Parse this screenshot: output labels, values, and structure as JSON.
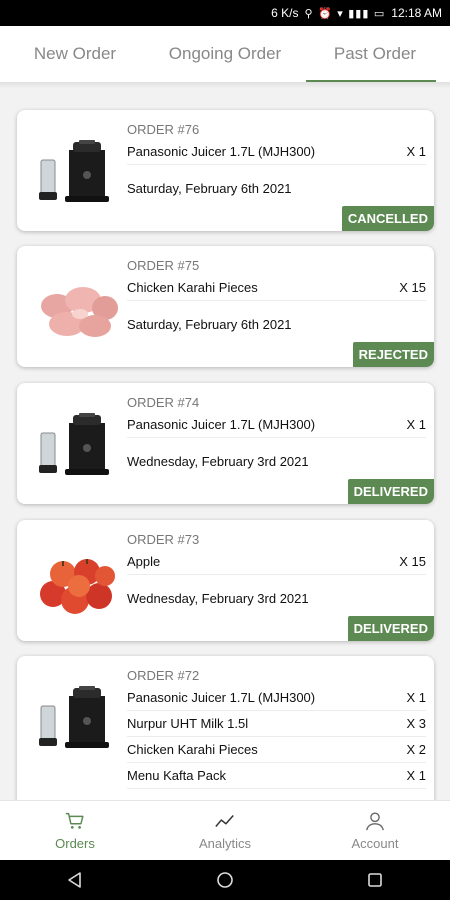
{
  "status_bar": {
    "speed": "6 K/s",
    "icons": "⚲ ⏰ ▾ ▮▮▮ ▭",
    "time": "12:18 AM"
  },
  "tabs": [
    {
      "label": "New Order",
      "active": false
    },
    {
      "label": "Ongoing Order",
      "active": false
    },
    {
      "label": "Past Order",
      "active": true
    }
  ],
  "orders": [
    {
      "number": "ORDER #76",
      "thumbnail": "juicer",
      "items": [
        {
          "name": "Panasonic Juicer 1.7L (MJH300)",
          "qty": "X 1"
        }
      ],
      "date": "Saturday, February 6th 2021",
      "status": "CANCELLED"
    },
    {
      "number": "ORDER #75",
      "thumbnail": "chicken-pieces",
      "items": [
        {
          "name": "Chicken Karahi Pieces",
          "qty": "X 15"
        }
      ],
      "date": "Saturday, February 6th 2021",
      "status": "REJECTED"
    },
    {
      "number": "ORDER #74",
      "thumbnail": "juicer",
      "items": [
        {
          "name": "Panasonic Juicer 1.7L (MJH300)",
          "qty": "X 1"
        }
      ],
      "date": "Wednesday, February 3rd 2021",
      "status": "DELIVERED"
    },
    {
      "number": "ORDER #73",
      "thumbnail": "apples",
      "items": [
        {
          "name": "Apple",
          "qty": "X 15"
        }
      ],
      "date": "Wednesday, February 3rd 2021",
      "status": "DELIVERED"
    },
    {
      "number": "ORDER #72",
      "thumbnail": "juicer",
      "items": [
        {
          "name": "Panasonic Juicer 1.7L (MJH300)",
          "qty": "X 1"
        },
        {
          "name": "Nurpur UHT Milk 1.5l",
          "qty": "X 3"
        },
        {
          "name": "Chicken Karahi Pieces",
          "qty": "X 2"
        },
        {
          "name": "Menu Kafta Pack",
          "qty": "X 1"
        }
      ],
      "date": "",
      "status": ""
    }
  ],
  "bottom_nav": [
    {
      "label": "Orders",
      "icon": "cart-icon",
      "active": true
    },
    {
      "label": "Analytics",
      "icon": "analytics-icon",
      "active": false
    },
    {
      "label": "Account",
      "icon": "user-icon",
      "active": false
    }
  ],
  "colors": {
    "accent": "#5c8a52",
    "badge_text": "#ffffff",
    "background": "#f2f2f2"
  }
}
